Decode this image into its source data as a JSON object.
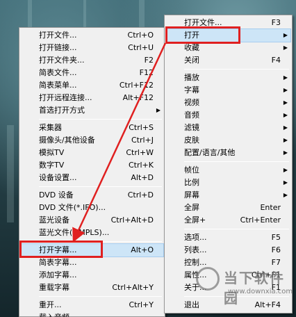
{
  "left_menu": [
    {
      "label": "打开文件...",
      "shortcut": "Ctrl+O"
    },
    {
      "label": "打开链接...",
      "shortcut": "Ctrl+U"
    },
    {
      "label": "打开文件夹...",
      "shortcut": "F2"
    },
    {
      "label": "简表文件...",
      "shortcut": "F12"
    },
    {
      "label": "简表菜单...",
      "shortcut": "Ctrl+F12"
    },
    {
      "label": "打开远程连接...",
      "shortcut": "Alt+F12"
    },
    {
      "label": "首选打开方式",
      "shortcut": "",
      "submenu": true
    },
    {
      "sep": true
    },
    {
      "label": "采集器",
      "shortcut": "Ctrl+S"
    },
    {
      "label": "摄像头/其他设备",
      "shortcut": "Ctrl+J"
    },
    {
      "label": "模拟TV",
      "shortcut": "Ctrl+W"
    },
    {
      "label": "数字TV",
      "shortcut": "Ctrl+K"
    },
    {
      "label": "设备设置...",
      "shortcut": "Alt+D"
    },
    {
      "sep": true
    },
    {
      "label": "DVD 设备",
      "shortcut": "Ctrl+D"
    },
    {
      "label": "DVD 文件(*.IFO)...",
      "shortcut": ""
    },
    {
      "label": "蓝光设备",
      "shortcut": "Ctrl+Alt+D"
    },
    {
      "label": "蓝光文件(*.MPLS)...",
      "shortcut": ""
    },
    {
      "sep": true
    },
    {
      "label": "打开字幕...",
      "shortcut": "Alt+O",
      "highlight": true
    },
    {
      "label": "简表字幕...",
      "shortcut": ""
    },
    {
      "label": "添加字幕...",
      "shortcut": ""
    },
    {
      "label": "重载字幕",
      "shortcut": "Ctrl+Alt+Y"
    },
    {
      "sep": true
    },
    {
      "label": "重开...",
      "shortcut": "Ctrl+Y"
    },
    {
      "label": "载入音频...",
      "shortcut": ""
    }
  ],
  "right_menu": [
    {
      "label": "打开文件...",
      "shortcut": "F3"
    },
    {
      "label": "打开",
      "shortcut": "",
      "submenu": true,
      "highlight": true
    },
    {
      "label": "收藏",
      "shortcut": "",
      "submenu": true
    },
    {
      "label": "关闭",
      "shortcut": "F4"
    },
    {
      "sep": true
    },
    {
      "label": "播放",
      "shortcut": "",
      "submenu": true
    },
    {
      "label": "字幕",
      "shortcut": "",
      "submenu": true
    },
    {
      "label": "视频",
      "shortcut": "",
      "submenu": true
    },
    {
      "label": "音频",
      "shortcut": "",
      "submenu": true
    },
    {
      "label": "滤镜",
      "shortcut": "",
      "submenu": true
    },
    {
      "label": "皮肤",
      "shortcut": "",
      "submenu": true
    },
    {
      "label": "配置/语言/其他",
      "shortcut": "",
      "submenu": true
    },
    {
      "sep": true
    },
    {
      "label": "帧位",
      "shortcut": "",
      "submenu": true
    },
    {
      "label": "比例",
      "shortcut": "",
      "submenu": true
    },
    {
      "label": "屏幕",
      "shortcut": "",
      "submenu": true
    },
    {
      "label": "全屏",
      "shortcut": "Enter"
    },
    {
      "label": "全屏+",
      "shortcut": "Ctrl+Enter"
    },
    {
      "sep": true
    },
    {
      "label": "选项...",
      "shortcut": "F5"
    },
    {
      "label": "列表...",
      "shortcut": "F6"
    },
    {
      "label": "控制...",
      "shortcut": "F7"
    },
    {
      "label": "属性...",
      "shortcut": "Ctrl+F1"
    },
    {
      "label": "关于...",
      "shortcut": "F1"
    },
    {
      "sep": true
    },
    {
      "label": "退出",
      "shortcut": "Alt+F4"
    }
  ],
  "watermark": {
    "text": "当下软件园",
    "url": "www.downxia.com"
  },
  "colors": {
    "highlight": "#cde5f7",
    "annotation_red": "#e02020",
    "menu_bg": "#f0f0f0"
  }
}
